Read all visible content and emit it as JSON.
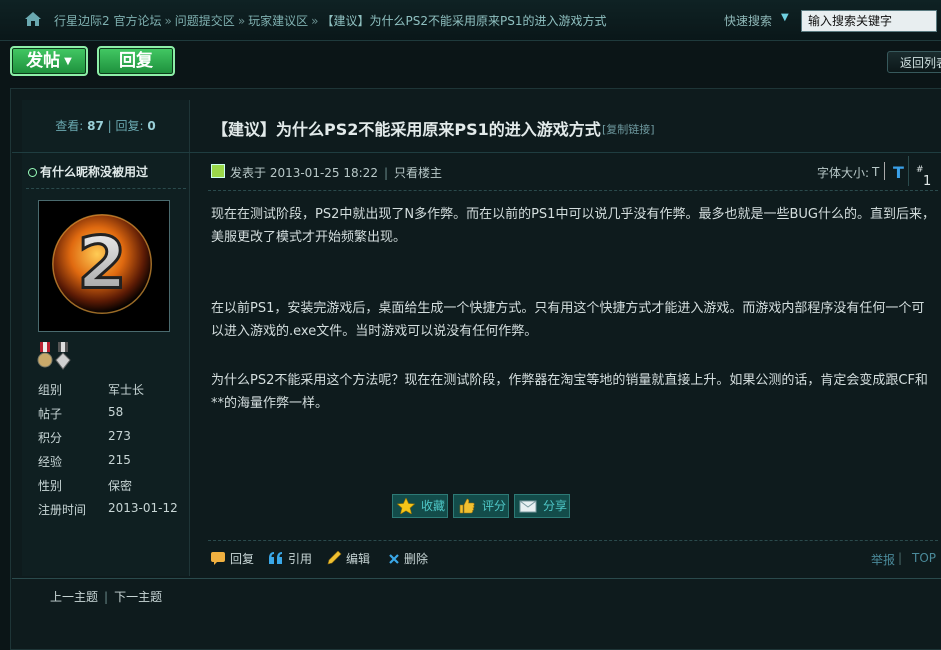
{
  "breadcrumb": {
    "items": [
      "行星边际2 官方论坛",
      "问题提交区",
      "玩家建议区",
      "【建议】为什么PS2不能采用原来PS1的进入游戏方式"
    ],
    "separator": "»"
  },
  "search": {
    "label": "快速搜索",
    "placeholder": "输入搜索关键字"
  },
  "actions": {
    "post_label": "发帖",
    "reply_label": "回复",
    "back_label": "返回列表"
  },
  "stats": {
    "views_label": "查看:",
    "views": "87",
    "replies_label": "回复:",
    "replies": "0"
  },
  "post": {
    "title": "【建议】为什么PS2不能采用原来PS1的进入游戏方式",
    "copy_link": "[复制链接]",
    "meta_posted": "发表于 2013-01-25 18:22",
    "meta_only_author": "只看楼主",
    "font_size_label": "字体大小:",
    "font_small": "T",
    "font_large": "T",
    "floor": "1",
    "floor_suffix": "#",
    "paragraphs": [
      "现在在测试阶段，PS2中就出现了N多作弊。而在以前的PS1中可以说几乎没有作弊。最多也就是一些BUG什么的。直到后来，美服更改了模式才开始频繁出现。",
      "在以前PS1，安装完游戏后，桌面给生成一个快捷方式。只有用这个快捷方式才能进入游戏。而游戏内部程序没有任何一个可以进入游戏的.exe文件。当时游戏可以说没有任何作弊。",
      "为什么PS2不能采用这个方法呢？现在在测试阶段，作弊器在淘宝等地的销量就直接上升。如果公测的话，肯定会变成跟CF和**的海量作弊一样。"
    ],
    "fav_label": "收藏",
    "rate_label": "评分",
    "share_label": "分享",
    "footer": {
      "reply": "回复",
      "quote": "引用",
      "edit": "编辑",
      "delete": "删除",
      "report": "举报",
      "sep": "|",
      "top": "TOP"
    }
  },
  "author": {
    "name": "有什么昵称没被用过",
    "avatar_text": "2",
    "profile": [
      {
        "key": "组别",
        "value": "军士长"
      },
      {
        "key": "帖子",
        "value": "58"
      },
      {
        "key": "积分",
        "value": "273"
      },
      {
        "key": "经验",
        "value": "215"
      },
      {
        "key": "性别",
        "value": "保密"
      },
      {
        "key": "注册时间",
        "value": "2013-01-12"
      }
    ]
  },
  "thread_nav": {
    "prev": "上一主题",
    "next": "下一主题",
    "sep": "|"
  },
  "colors": {
    "background": "#0b1517",
    "accent_green": "#2fb04e",
    "chip_teal": "#134c4a",
    "link_blue": "#3aa0e8"
  }
}
